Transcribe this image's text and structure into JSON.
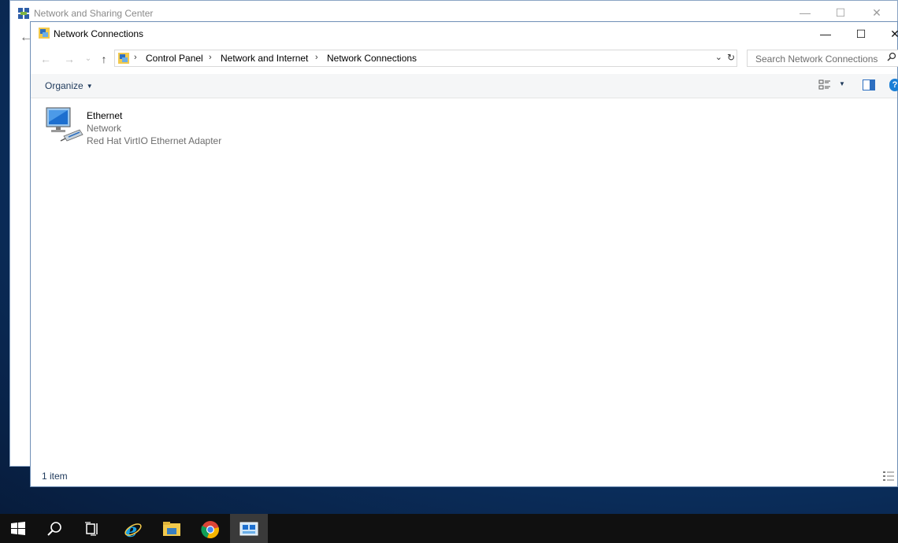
{
  "back_window": {
    "title": "Network and Sharing Center",
    "icon": "network-center-icon",
    "controls": {
      "minimize": "—",
      "maximize": "☐",
      "close": "✕"
    },
    "back_arrow": "←"
  },
  "window": {
    "title": "Network Connections",
    "icon": "network-connections-icon",
    "controls": {
      "minimize": "—",
      "maximize": "☐",
      "close": "✕"
    }
  },
  "navigation": {
    "back": "←",
    "forward": "→",
    "recent": "⌄",
    "up": "↑",
    "breadcrumbs": [
      "Control Panel",
      "Network and Internet",
      "Network Connections"
    ],
    "separator": "›",
    "dropdown": "⌄",
    "refresh": "↻"
  },
  "search": {
    "placeholder": "Search Network Connections",
    "icon": "search-icon"
  },
  "command_bar": {
    "organize_label": "Organize",
    "caret": "▼",
    "help": "?"
  },
  "items": [
    {
      "name": "Ethernet",
      "status": "Network",
      "adapter": "Red Hat VirtIO Ethernet Adapter",
      "icon": "network-adapter-icon"
    }
  ],
  "status_bar": {
    "count": "1 item"
  },
  "taskbar": {
    "items": [
      "start-icon",
      "search-icon",
      "task-view-icon",
      "internet-explorer-icon",
      "file-explorer-icon",
      "chrome-icon",
      "network-window-icon"
    ],
    "colors": {
      "background": "#101010",
      "active": "#3a3a3a",
      "accent": "#1a7fd6"
    }
  }
}
